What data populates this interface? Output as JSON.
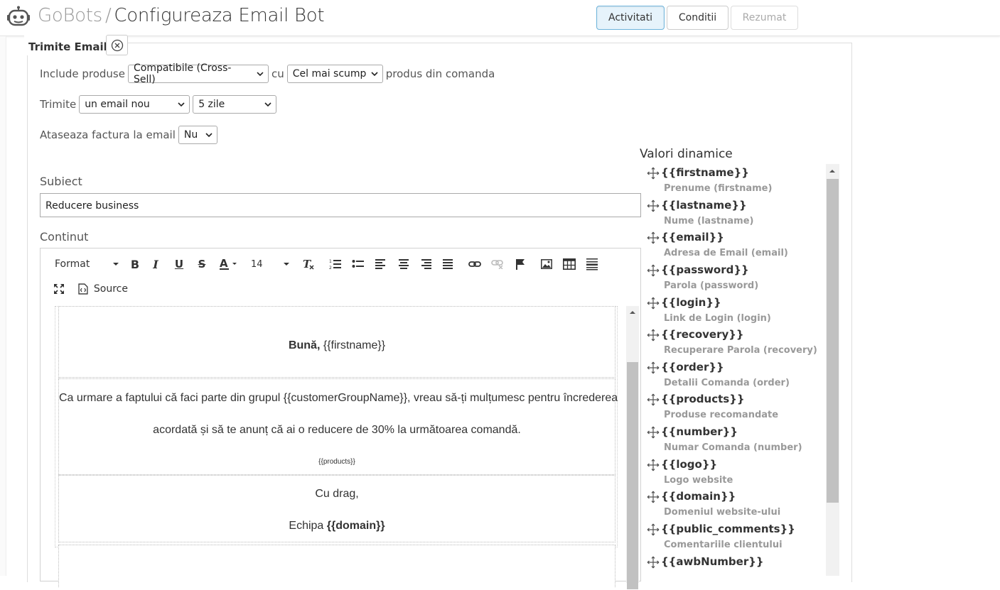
{
  "header": {
    "brand": "GoBots",
    "separator": "/",
    "title": "Configureaza Email Bot",
    "tabs": [
      {
        "label": "Activitati",
        "state": "active"
      },
      {
        "label": "Conditii",
        "state": "normal"
      },
      {
        "label": "Rezumat",
        "state": "disabled"
      }
    ]
  },
  "section": {
    "legend": "Trimite Email",
    "close_icon": "circle-x-icon"
  },
  "form": {
    "include_label": "Include produse",
    "include_type": "Compatibile (Cross-Sell)",
    "include_connector": "cu",
    "include_sort": "Cel mai scump",
    "include_suffix": "produs din comanda",
    "send_label": "Trimite",
    "send_mode": "un email nou",
    "send_delay": "5 zile",
    "attach_label": "Ataseaza factura la email",
    "attach_value": "Nu",
    "subject_label": "Subiect",
    "subject_value": "Reducere business",
    "content_label": "Continut"
  },
  "editor": {
    "format_label": "Format",
    "font_size": "14",
    "source_label": "Source",
    "greeting_bold": "Bună,",
    "greeting_var": "{{firstname}}",
    "body_line1": "Ca urmare a faptului că faci parte din grupul {{customerGroupName}}, vreau să-ți mulțumesc pentru încrederea",
    "body_line2": "acordată și să te anunț că ai o reducere de 30% la următoarea comandă.",
    "products_var": "{{products}}",
    "signoff": "Cu drag,",
    "team_prefix": "Echipa",
    "team_var": "{{domain}}"
  },
  "dynamic": {
    "title": "Valori dinamice",
    "items": [
      {
        "tag": "{{firstname}}",
        "desc": "Prenume (firstname)"
      },
      {
        "tag": "{{lastname}}",
        "desc": "Nume (lastname)"
      },
      {
        "tag": "{{email}}",
        "desc": "Adresa de Email (email)"
      },
      {
        "tag": "{{password}}",
        "desc": "Parola (password)"
      },
      {
        "tag": "{{login}}",
        "desc": "Link de Login (login)"
      },
      {
        "tag": "{{recovery}}",
        "desc": "Recuperare Parola (recovery)"
      },
      {
        "tag": "{{order}}",
        "desc": "Detalii Comanda (order)"
      },
      {
        "tag": "{{products}}",
        "desc": "Produse recomandate"
      },
      {
        "tag": "{{number}}",
        "desc": "Numar Comanda (number)"
      },
      {
        "tag": "{{logo}}",
        "desc": "Logo website"
      },
      {
        "tag": "{{domain}}",
        "desc": "Domeniul website-ului"
      },
      {
        "tag": "{{public_comments}}",
        "desc": "Comentariile clientului"
      },
      {
        "tag": "{{awbNumber}}",
        "desc": ""
      }
    ]
  },
  "colors": {
    "active_tab_bg": "#e6f3fb",
    "active_tab_border": "#6fb5dc",
    "muted_text": "#999999"
  }
}
